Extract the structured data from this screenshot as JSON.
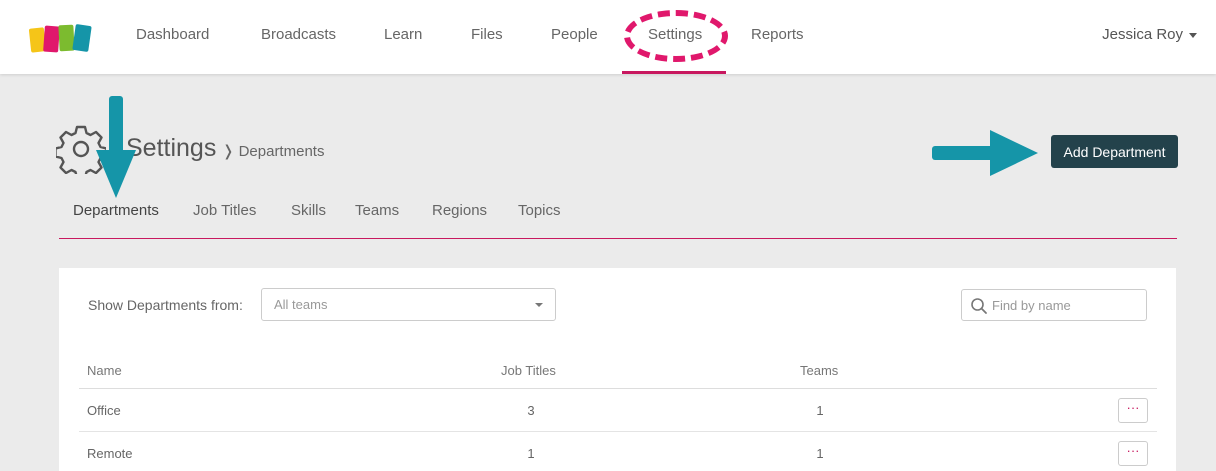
{
  "nav": {
    "items": [
      {
        "label": "Dashboard"
      },
      {
        "label": "Broadcasts"
      },
      {
        "label": "Learn"
      },
      {
        "label": "Files"
      },
      {
        "label": "People"
      },
      {
        "label": "Settings",
        "active": true
      },
      {
        "label": "Reports"
      }
    ],
    "user": "Jessica Roy"
  },
  "header": {
    "title": "Settings",
    "breadcrumb_sep": "❭",
    "breadcrumb": "Departments",
    "add_button": "Add Department"
  },
  "subtabs": [
    {
      "label": "Departments",
      "active": true
    },
    {
      "label": "Job Titles"
    },
    {
      "label": "Skills"
    },
    {
      "label": "Teams"
    },
    {
      "label": "Regions"
    },
    {
      "label": "Topics"
    }
  ],
  "filter": {
    "label": "Show Departments from:",
    "selected": "All teams",
    "search_placeholder": "Find by name"
  },
  "table": {
    "headers": [
      "Name",
      "Job Titles",
      "Teams"
    ],
    "rows": [
      {
        "name": "Office",
        "job_titles": "3",
        "teams": "1",
        "actions": "···"
      },
      {
        "name": "Remote",
        "job_titles": "1",
        "teams": "1",
        "actions": "···"
      }
    ]
  },
  "colors": {
    "accent": "#c8185f",
    "annotation_highlight": "#e0186c",
    "annotation_arrow": "#1595a8",
    "button_dark": "#23424b"
  },
  "icons": [
    "logo-icon",
    "gear-icon",
    "search-icon",
    "caret-down-icon",
    "chevron-right-icon",
    "more-icon"
  ]
}
